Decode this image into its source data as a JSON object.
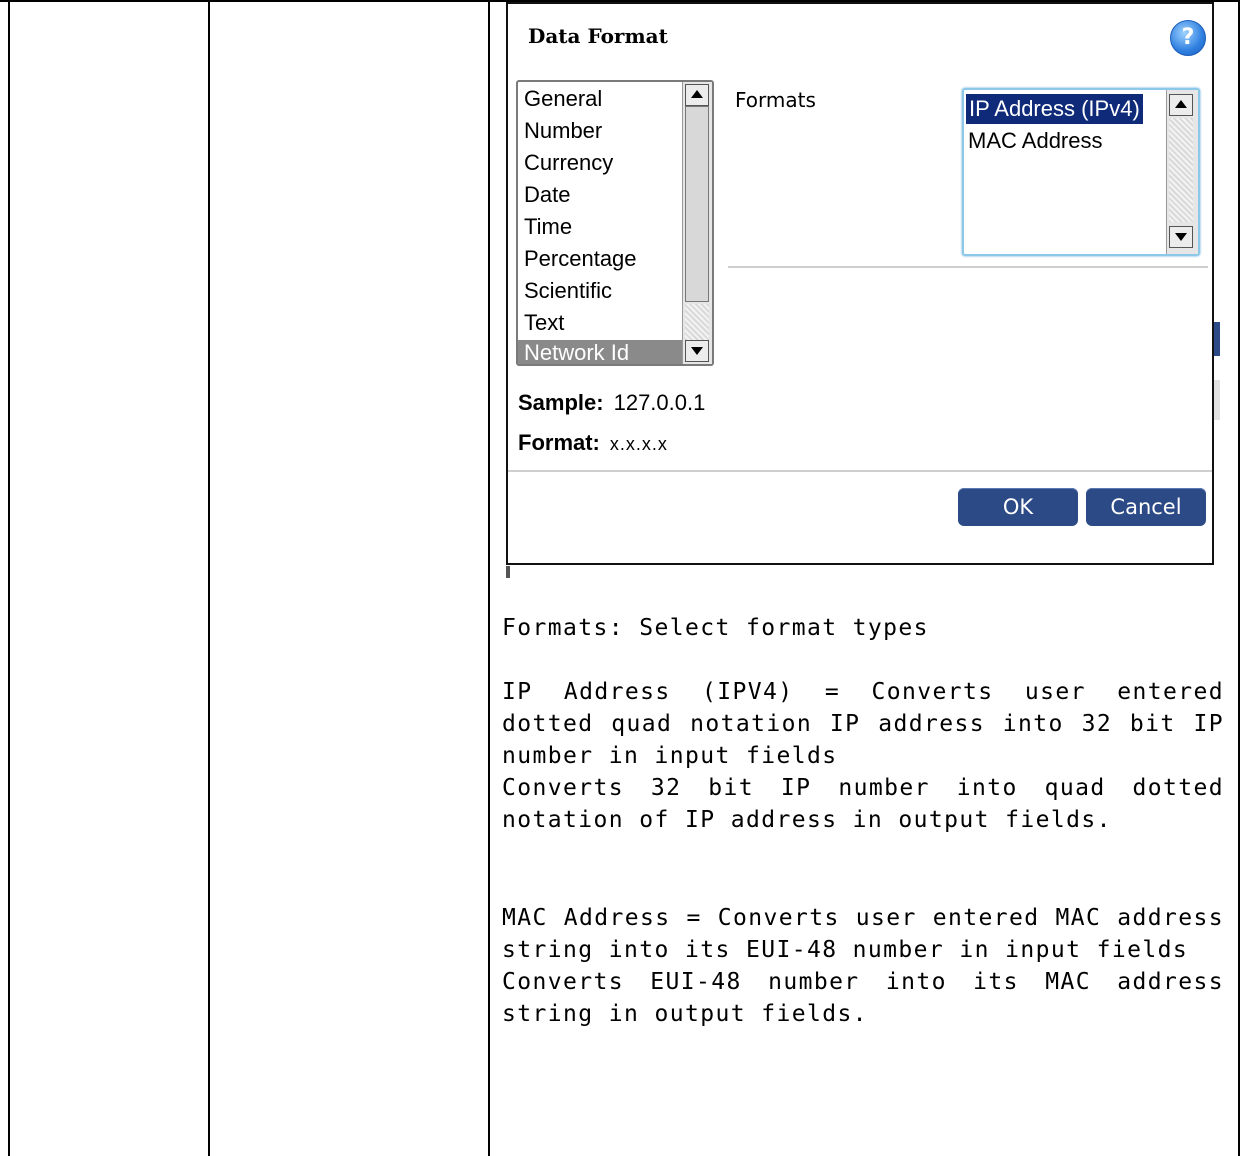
{
  "dialog": {
    "title": "Data Format",
    "help_icon": "question-icon",
    "categories": [
      "General",
      "Number",
      "Currency",
      "Date",
      "Time",
      "Percentage",
      "Scientific",
      "Text",
      "Network Id"
    ],
    "selected_category": "Network Id",
    "formats_label": "Formats",
    "formats": [
      "IP Address (IPv4)",
      "MAC Address"
    ],
    "selected_format": "IP Address (IPv4)",
    "sample_label": "Sample:",
    "sample_value": "127.0.0.1",
    "format_label": "Format:",
    "format_value": "x.x.x.x",
    "ok_label": "OK",
    "cancel_label": "Cancel"
  },
  "description": {
    "intro": "Formats: Select format types",
    "ip_def": "IP Address (IPV4)   = Converts user entered dotted quad notation IP address into 32 bit IP number in input fields",
    "ip_output": "Converts 32 bit IP number into quad dotted notation of IP address in output fields.",
    "mac_def": "MAC Address = Converts user entered MAC address string into its EUI-48 number in input fields",
    "mac_output": "Converts EUI-48 number into its MAC address string in output fields."
  },
  "colors": {
    "button": "#2b4a86",
    "selected_format_bg": "#102a7a",
    "selected_category_bg": "#8a8a8a",
    "help_icon": "#2f7fe0"
  }
}
